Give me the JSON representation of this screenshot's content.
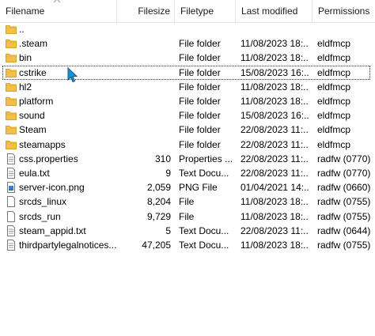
{
  "columns": {
    "filename": "Filename",
    "filesize": "Filesize",
    "filetype": "Filetype",
    "last_modified": "Last modified",
    "permissions": "Permissions"
  },
  "colors": {
    "folder": "#f2c04a",
    "folder_dark": "#d9a22a",
    "file_border": "#7a7a7a",
    "cursor": "#1f8fd8"
  },
  "rows": [
    {
      "icon": "folder-icon",
      "name": "..",
      "size": "",
      "type": "",
      "modified": "",
      "permissions": ""
    },
    {
      "icon": "folder-icon",
      "name": ".steam",
      "size": "",
      "type": "File folder",
      "modified": "11/08/2023 18:...",
      "permissions": "eldfmcp"
    },
    {
      "icon": "folder-icon",
      "name": "bin",
      "size": "",
      "type": "File folder",
      "modified": "11/08/2023 18:...",
      "permissions": "eldfmcp"
    },
    {
      "icon": "folder-icon",
      "name": "cstrike",
      "size": "",
      "type": "File folder",
      "modified": "15/08/2023 16:...",
      "permissions": "eldfmcp",
      "focused": true
    },
    {
      "icon": "folder-icon",
      "name": "hl2",
      "size": "",
      "type": "File folder",
      "modified": "11/08/2023 18:...",
      "permissions": "eldfmcp"
    },
    {
      "icon": "folder-icon",
      "name": "platform",
      "size": "",
      "type": "File folder",
      "modified": "11/08/2023 18:...",
      "permissions": "eldfmcp"
    },
    {
      "icon": "folder-icon",
      "name": "sound",
      "size": "",
      "type": "File folder",
      "modified": "15/08/2023 16:...",
      "permissions": "eldfmcp"
    },
    {
      "icon": "folder-icon",
      "name": "Steam",
      "size": "",
      "type": "File folder",
      "modified": "22/08/2023 11:...",
      "permissions": "eldfmcp"
    },
    {
      "icon": "folder-icon",
      "name": "steamapps",
      "size": "",
      "type": "File folder",
      "modified": "22/08/2023 11:...",
      "permissions": "eldfmcp"
    },
    {
      "icon": "text-file-icon",
      "name": "css.properties",
      "size": "310",
      "type": "Properties ...",
      "modified": "22/08/2023 11:...",
      "permissions": "radfw (0770)"
    },
    {
      "icon": "text-file-icon",
      "name": "eula.txt",
      "size": "9",
      "type": "Text Docu...",
      "modified": "22/08/2023 11:...",
      "permissions": "radfw (0770)"
    },
    {
      "icon": "image-file-icon",
      "name": "server-icon.png",
      "size": "2,059",
      "type": "PNG File",
      "modified": "01/04/2021 14:...",
      "permissions": "radfw (0660)"
    },
    {
      "icon": "blank-file-icon",
      "name": "srcds_linux",
      "size": "8,204",
      "type": "File",
      "modified": "11/08/2023 18:...",
      "permissions": "radfw (0755)"
    },
    {
      "icon": "blank-file-icon",
      "name": "srcds_run",
      "size": "9,729",
      "type": "File",
      "modified": "11/08/2023 18:...",
      "permissions": "radfw (0755)"
    },
    {
      "icon": "text-file-icon",
      "name": "steam_appid.txt",
      "size": "5",
      "type": "Text Docu...",
      "modified": "22/08/2023 11:...",
      "permissions": "radfw (0644)"
    },
    {
      "icon": "text-file-icon",
      "name": "thirdpartylegalnotices...",
      "size": "47,205",
      "type": "Text Docu...",
      "modified": "11/08/2023 18:...",
      "permissions": "radfw (0755)"
    }
  ]
}
